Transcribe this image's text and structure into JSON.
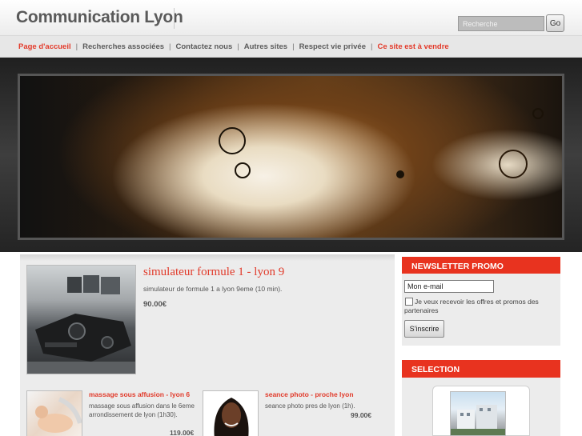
{
  "header": {
    "site_title": "Communication Lyon",
    "search_placeholder": "Recherche",
    "search_button": "Go"
  },
  "nav": {
    "items": [
      {
        "label": "Page d'accueil",
        "highlight": true
      },
      {
        "label": "Recherches associées",
        "highlight": false
      },
      {
        "label": "Contactez nous",
        "highlight": false
      },
      {
        "label": "Autres sites",
        "highlight": false
      },
      {
        "label": "Respect vie privée",
        "highlight": false
      },
      {
        "label": "Ce site est à vendre",
        "highlight": true
      }
    ],
    "separator": "|"
  },
  "featured": {
    "title": "simulateur formule 1 - lyon 9",
    "description": "simulateur de formule 1 a lyon 9eme (10 min).",
    "price": "90.00€"
  },
  "cards": [
    {
      "title": "massage sous affusion - lyon 6",
      "description": "massage sous affusion dans le 6eme arrondissement de lyon (1h30).",
      "price": "119.00€"
    },
    {
      "title": "seance photo - proche lyon",
      "description": "seance photo pres de lyon (1h).",
      "price": "99.00€"
    }
  ],
  "sidebar": {
    "newsletter": {
      "heading": "NEWSLETTER PROMO",
      "email_value": "Mon e-mail",
      "consent_label": "Je veux recevoir les offres et promos des partenaires",
      "subscribe_button": "S'inscrire"
    },
    "selection": {
      "heading": "SELECTION"
    }
  },
  "colors": {
    "accent_red": "#e8331f",
    "link_red": "#e13a2a",
    "text_gray": "#5a5a5a"
  }
}
